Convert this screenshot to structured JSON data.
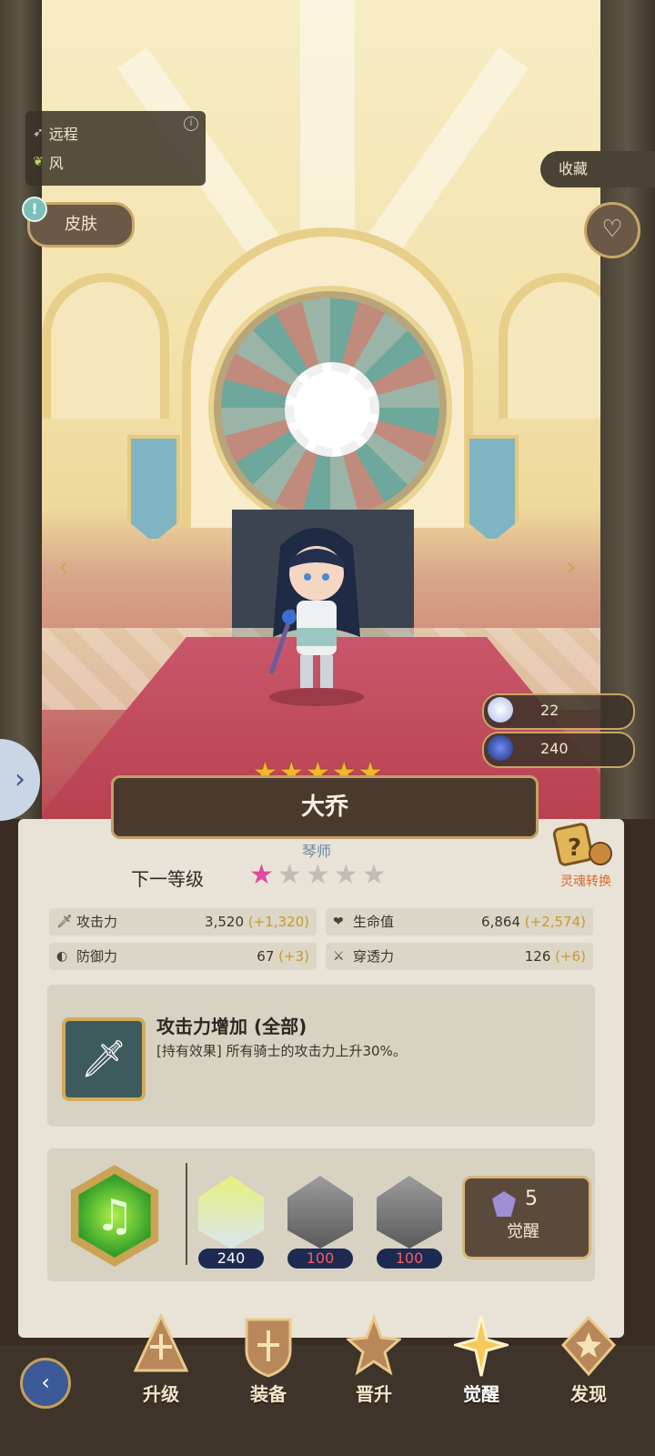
{
  "hero": {
    "attack_type": "远程",
    "element": "风",
    "name": "大乔",
    "stars": 5,
    "class": "琴师"
  },
  "buttons": {
    "skin": "皮肤",
    "favorite": "收藏",
    "alert": "!"
  },
  "resources": [
    {
      "name": "white-crystal",
      "value": "22",
      "color": "#d9e4ff"
    },
    {
      "name": "blue-crystal",
      "value": "240",
      "color": "#3b4fa8"
    }
  ],
  "awaken": {
    "next_level_label": "下一等级",
    "filled_stars": 1,
    "total_stars": 5,
    "soul_convert_label": "灵魂转换"
  },
  "stats": [
    {
      "icon": "sword-icon",
      "label": "攻击力",
      "value": "3,520",
      "bonus": "(+1,320)"
    },
    {
      "icon": "heart-icon",
      "label": "生命值",
      "value": "6,864",
      "bonus": "(+2,574)"
    },
    {
      "icon": "shield-icon",
      "label": "防御力",
      "value": "67",
      "bonus": "(+3)"
    },
    {
      "icon": "pierce-icon",
      "label": "穿透力",
      "value": "126",
      "bonus": "(+6)"
    }
  ],
  "effect": {
    "title": "攻击力增加 (全部)",
    "description": "[持有效果] 所有骑士的攻击力上升30%。"
  },
  "materials": [
    {
      "name": "hero-portrait",
      "count": "240"
    },
    {
      "name": "wind-stone-1",
      "count": "100"
    },
    {
      "name": "wind-stone-2",
      "count": "100"
    }
  ],
  "awaken_button": {
    "cost": "5",
    "label": "觉醒"
  },
  "nav": [
    {
      "label": "升级",
      "icon": "upgrade-icon"
    },
    {
      "label": "装备",
      "icon": "equip-icon"
    },
    {
      "label": "晋升",
      "icon": "promote-icon"
    },
    {
      "label": "觉醒",
      "icon": "awaken-icon",
      "active": true
    },
    {
      "label": "发现",
      "icon": "discover-icon"
    }
  ],
  "colors": {
    "panel": "#e8e3d6",
    "accent_gold": "#c5a06a",
    "bonus": "#c79a2e",
    "awaken_pink": "#e24aa1"
  }
}
